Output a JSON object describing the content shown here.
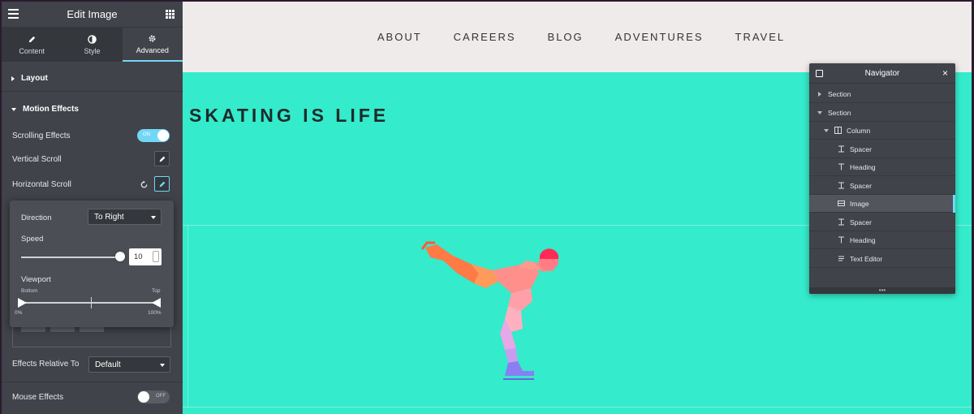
{
  "panel": {
    "title": "Edit Image",
    "tabs": [
      {
        "label": "Content",
        "icon": "pencil-icon"
      },
      {
        "label": "Style",
        "icon": "half-circle-icon"
      },
      {
        "label": "Advanced",
        "icon": "gear-icon"
      }
    ],
    "active_tab": "Advanced",
    "layout_section": "Layout",
    "motion_section": "Motion Effects",
    "scrolling_effects": {
      "label": "Scrolling Effects",
      "toggle_text": "ON",
      "state": "on"
    },
    "vertical_scroll": "Vertical Scroll",
    "horizontal_scroll": "Horizontal Scroll",
    "popover": {
      "direction_label": "Direction",
      "direction_value": "To Right",
      "speed_label": "Speed",
      "speed_value": "10",
      "viewport_label": "Viewport",
      "viewport_bottom_label": "Bottom",
      "viewport_top_label": "Top",
      "viewport_min_text": "0%",
      "viewport_max_text": "100%",
      "speed_level": 0.98,
      "viewport_min": 0,
      "viewport_max": 100
    },
    "effects_relative_to": {
      "label": "Effects Relative To",
      "value": "Default"
    },
    "mouse_effects": {
      "label": "Mouse Effects",
      "toggle_text": "OFF",
      "state": "off"
    }
  },
  "site": {
    "nav": [
      "ABOUT",
      "CAREERS",
      "BLOG",
      "ADVENTURES",
      "TRAVEL"
    ],
    "heading": "SKATING IS LIFE",
    "background_color": "#34ebcb",
    "header_color": "#f0ebeb"
  },
  "navigator": {
    "title": "Navigator",
    "items": [
      {
        "label": "Section",
        "type": "section",
        "expanded": false
      },
      {
        "label": "Section",
        "type": "section",
        "expanded": true
      },
      {
        "label": "Column",
        "type": "column",
        "expanded": true
      },
      {
        "label": "Spacer",
        "type": "spacer"
      },
      {
        "label": "Heading",
        "type": "heading"
      },
      {
        "label": "Spacer",
        "type": "spacer"
      },
      {
        "label": "Image",
        "type": "image",
        "selected": true
      },
      {
        "label": "Spacer",
        "type": "spacer"
      },
      {
        "label": "Heading",
        "type": "heading"
      },
      {
        "label": "Text Editor",
        "type": "text-editor"
      }
    ]
  },
  "colors": {
    "accent": "#71d7f7",
    "panel": "#404349",
    "panel_dark": "#34373c"
  }
}
